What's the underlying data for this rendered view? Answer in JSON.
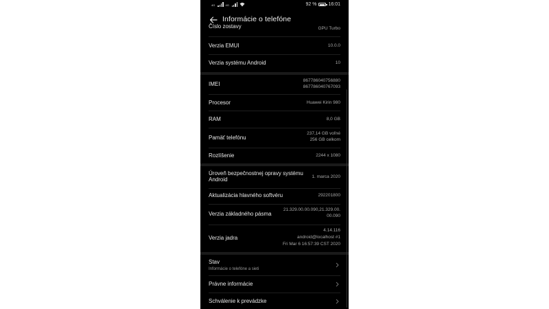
{
  "status_bar": {
    "signal1_label": "4G",
    "signal2_label": "4G",
    "battery_percent": "92 %",
    "battery_level": 0.92,
    "time": "16:01"
  },
  "header": {
    "title": "Informácie o telefóne"
  },
  "rows_top": [
    {
      "label": "Číslo zostavy",
      "value": "GPU Turbo"
    },
    {
      "label": "Verzia EMUI",
      "value": "10.0.0"
    },
    {
      "label": "Verzia systému Android",
      "value": "10"
    }
  ],
  "rows_hw": [
    {
      "label": "IMEI",
      "value_lines": [
        "867786040756880",
        "867786040767093"
      ]
    },
    {
      "label": "Procesor",
      "value_lines": [
        "Huawei Kirin 980"
      ]
    },
    {
      "label": "RAM",
      "value_lines": [
        "8,0 GB"
      ]
    },
    {
      "label": "Pamäť telefónu",
      "value_lines": [
        "237,14  GB voľné",
        "256  GB celkom"
      ]
    },
    {
      "label": "Rozlíšenie",
      "value_lines": [
        "2244 x 1080"
      ]
    }
  ],
  "rows_sw": [
    {
      "label_lines": [
        "Úroveň bezpečnostnej opravy systému",
        "Android"
      ],
      "value_lines": [
        "1. marca 2020"
      ]
    },
    {
      "label_lines": [
        "Aktualizácia hlavného softvéru"
      ],
      "value_lines": [
        "292201800"
      ]
    },
    {
      "label_lines": [
        "Verzia základného pásma"
      ],
      "value_lines": [
        "21.329.00.00.090,21.329.00.",
        "00.090"
      ]
    },
    {
      "label_lines": [
        "Verzia jadra"
      ],
      "value_lines": [
        "4.14.116",
        "android@localhost #1",
        "Fri Mar 6 16:57:39 CST 2020"
      ]
    }
  ],
  "rows_nav": [
    {
      "label": "Stav",
      "sub": "Informácie o telefóne a sieti"
    },
    {
      "label": "Právne informácie",
      "sub": ""
    },
    {
      "label": "Schválenie k prevádzke",
      "sub": ""
    }
  ],
  "colors": {
    "background": "#000000",
    "text_primary": "#e8e8e8",
    "text_secondary": "#a8a8a8"
  }
}
